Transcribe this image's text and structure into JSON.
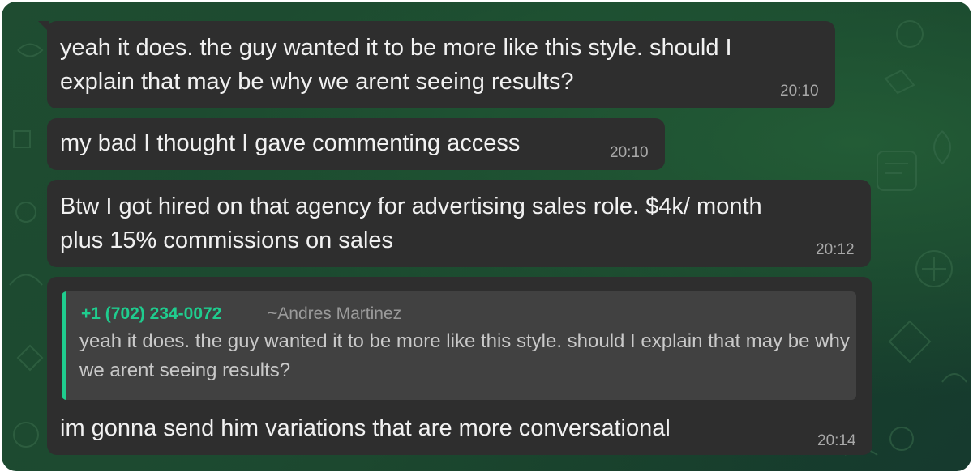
{
  "messages": [
    {
      "text": "yeah it does. the guy wanted it to be more like this style. should I\nexplain that may be why we arent seeing results?",
      "time": "20:10"
    },
    {
      "text": "my bad I thought I gave commenting access",
      "time": "20:10"
    },
    {
      "text": "Btw I got hired on that agency for advertising sales role. $4k/ month\nplus 15% commissions on sales",
      "time": "20:12"
    },
    {
      "reply": {
        "author": "+1 (702) 234-0072",
        "alias": "~Andres Martinez",
        "text": "yeah it does. the guy wanted it to be more like this style. should I explain that may be why we arent seeing results?"
      },
      "text": "im gonna send him variations that are more conversational",
      "time": "20:14"
    }
  ],
  "theme": {
    "bubble": "#2e2e2e",
    "quote_bg": "#414141",
    "accent": "#1fcc8e",
    "wallpaper": "#1b4a2f"
  },
  "icons": [
    "chat-wallpaper-doodles"
  ]
}
